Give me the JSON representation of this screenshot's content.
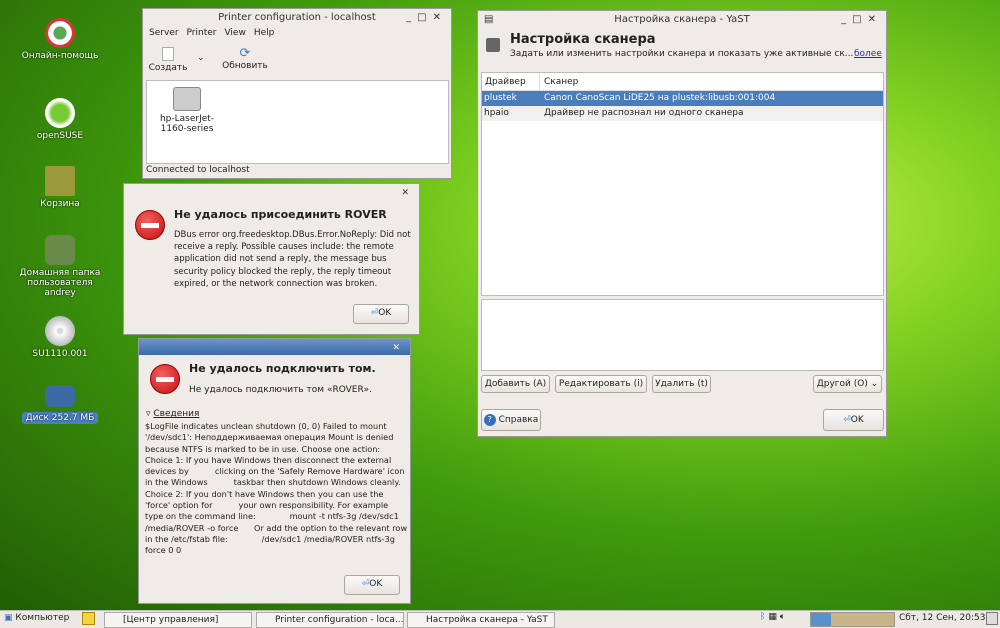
{
  "desktop": {
    "icons": [
      {
        "label": "Онлайн-помощь"
      },
      {
        "label": "openSUSE"
      },
      {
        "label": "Корзина"
      },
      {
        "label": "Домашняя папка пользователя andrey"
      },
      {
        "label": "SU1110.001"
      },
      {
        "label": "Диск 252.7 МБ"
      }
    ]
  },
  "printer": {
    "title": "Printer configuration - localhost",
    "menu": [
      "Server",
      "Printer",
      "View",
      "Help"
    ],
    "toolbar": {
      "create": "Создать",
      "refresh": "Обновить"
    },
    "printer_name": "hp-LaserJet-1160-series",
    "status": "Connected to localhost"
  },
  "dialog1": {
    "heading": "Не удалось присоединить ROVER",
    "text": "DBus error org.freedesktop.DBus.Error.NoReply: Did not receive a reply. Possible causes include: the remote application did not send a reply, the message bus security policy blocked the reply, the reply timeout expired, or the network connection was broken.",
    "ok": "OK"
  },
  "dialog2": {
    "heading": "Не удалось подключить том.",
    "subtext": "Не удалось подключить том «ROVER».",
    "details_label": "Сведения",
    "details": "$LogFile indicates unclean shutdown (0, 0) Failed to mount '/dev/sdc1': Неподдерживаемая операция Mount is denied because NTFS is marked to be in use. Choose one action:  Choice 1: If you have Windows then disconnect the external devices by          clicking on the 'Safely Remove Hardware' icon in the Windows          taskbar then shutdown Windows cleanly.  Choice 2: If you don't have Windows then you can use the 'force' option for          your own responsibility. For example type on the command line:             mount -t ntfs-3g /dev/sdc1 /media/ROVER -o force      Or add the option to the relevant row in the /etc/fstab file:             /dev/sdc1 /media/ROVER ntfs-3g force 0 0",
    "ok": "OK"
  },
  "yast": {
    "title": "Настройка сканера - YaST",
    "heading": "Настройка сканера",
    "subtitle": "Задать или изменить настройки сканера и показать уже активные ск...",
    "more_link": "более",
    "columns": [
      "Драйвер",
      "Сканер"
    ],
    "rows": [
      {
        "driver": "plustek",
        "scanner": "Canon CanoScan LiDE25 на plustek:libusb:001:004"
      },
      {
        "driver": "hpaio",
        "scanner": "Драйвер не распознал ни одного сканера"
      }
    ],
    "buttons": {
      "add": "Добавить (A)",
      "edit": "Редактировать (i)",
      "delete": "Удалить (t)",
      "other": "Другой (O)",
      "help": "Справка",
      "ok": "OK"
    }
  },
  "taskbar": {
    "computer": "Компьютер",
    "tasks": [
      "[Центр управления]",
      "Printer configuration - loca...",
      "Настройка сканера - YaST"
    ],
    "clock": "Сбт, 12 Сен, 20:53"
  }
}
